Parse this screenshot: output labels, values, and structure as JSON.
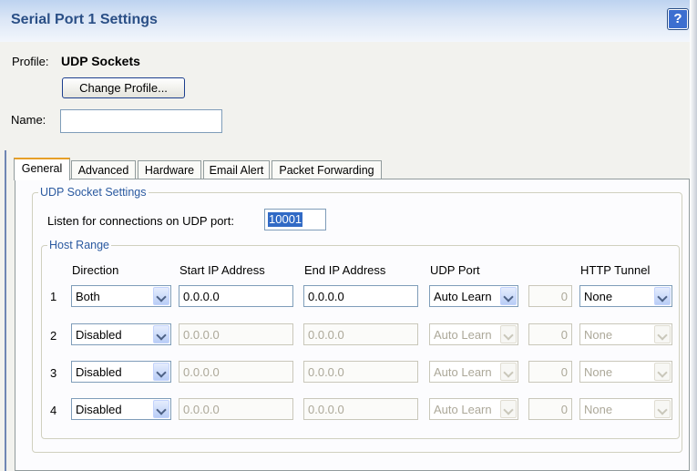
{
  "window": {
    "title": "Serial Port 1 Settings",
    "help_label": "?"
  },
  "profile": {
    "label": "Profile:",
    "value": "UDP Sockets",
    "change_button": "Change Profile..."
  },
  "name": {
    "label": "Name:",
    "value": ""
  },
  "tabs": [
    "General",
    "Advanced",
    "Hardware",
    "Email Alert",
    "Packet Forwarding"
  ],
  "active_tab": "General",
  "udp_socket_settings": {
    "legend": "UDP Socket Settings",
    "listen_label": "Listen for connections on UDP port:",
    "listen_port": "10001"
  },
  "host_range": {
    "legend": "Host Range",
    "columns": [
      "Direction",
      "Start IP Address",
      "End IP Address",
      "UDP Port",
      "HTTP Tunnel"
    ],
    "rows": [
      {
        "num": "1",
        "direction": "Both",
        "start_ip": "0.0.0.0",
        "end_ip": "0.0.0.0",
        "udp_port": "Auto Learn",
        "port_number": "0",
        "http_tunnel": "None"
      },
      {
        "num": "2",
        "direction": "Disabled",
        "start_ip": "0.0.0.0",
        "end_ip": "0.0.0.0",
        "udp_port": "Auto Learn",
        "port_number": "0",
        "http_tunnel": "None"
      },
      {
        "num": "3",
        "direction": "Disabled",
        "start_ip": "0.0.0.0",
        "end_ip": "0.0.0.0",
        "udp_port": "Auto Learn",
        "port_number": "0",
        "http_tunnel": "None"
      },
      {
        "num": "4",
        "direction": "Disabled",
        "start_ip": "0.0.0.0",
        "end_ip": "0.0.0.0",
        "udp_port": "Auto Learn",
        "port_number": "0",
        "http_tunnel": "None"
      }
    ]
  },
  "icons": {
    "help": "help-icon",
    "dropdown": "chevron-down-icon"
  },
  "colors": {
    "title_text": "#2a4f86",
    "legend_text": "#2b5aa0",
    "active_tab_accent": "#e6a028",
    "selection": "#316ac5"
  }
}
